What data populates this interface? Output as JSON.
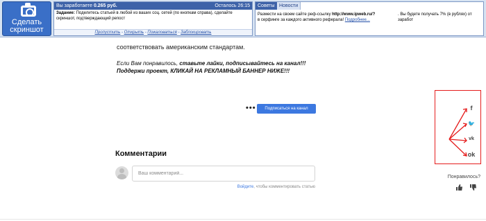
{
  "toolbar": {
    "screenshot_button": "Сделать скриншот",
    "earnings": {
      "earned_prefix": "Вы заработаете",
      "earned_amount": "0.265 руб.",
      "remaining": "Осталось 26:15",
      "task_label": "Задание:",
      "task_text": "Поделитесь статьей в любой из ваших соц. сетей (по кнопкам справа), сделайте скриншот, подтверждающий репост",
      "links": [
        "Пропустить",
        "Открыть",
        "Пожаловаться",
        "Заблокировать"
      ],
      "links_separator": " - "
    },
    "news": {
      "tab_advice": "Советы",
      "tab_news": "Новости",
      "text_before": "Размести на своем сайте реф-ссылку",
      "url": "http://www.ipweb.ru/?",
      "text_after": "в серфинге за каждого активного реферала!",
      "more_link": "Подробнее...",
      "right_text": ". Вы будете получать 7% (в рублях) от заработ"
    }
  },
  "article": {
    "line": "соответствовать американским стандартам.",
    "cta1_normal": "Если Вам понравилось,",
    "cta1_bold": " ставьте лайки, подписывайтесь на канал!!!",
    "cta2": "Поддержи проект, КЛИКАЙ НА РЕКЛАМНЫЙ БАННЕР НИЖЕ!!!",
    "more_dots": "•••",
    "subscribe": "Подписаться на канал"
  },
  "comments": {
    "title": "Комментарии",
    "placeholder": "Ваш комментарий...",
    "login_link": "Войдите",
    "login_suffix": ", чтобы комментировать статью"
  },
  "share": {
    "icons": [
      "facebook-icon",
      "twitter-icon",
      "vk-icon",
      "odnoklassniki-icon"
    ],
    "fb_glyph": "f",
    "tw_glyph": "🐦",
    "vk_glyph": "vk",
    "ok_glyph": "ok",
    "highlight_color": "#e51c1c"
  },
  "feedback": {
    "liked_label": "Понравилось?"
  }
}
